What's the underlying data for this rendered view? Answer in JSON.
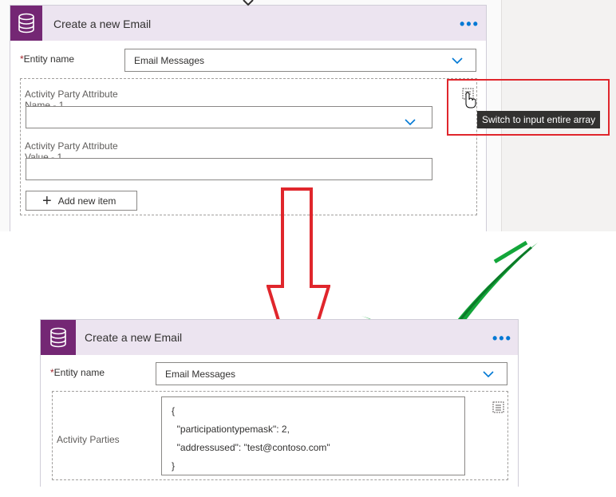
{
  "top": {
    "title": "Create a new Email",
    "more_label": "•••",
    "entity_label": "Entity name",
    "required_mark": "*",
    "entity_value": "Email Messages",
    "item": {
      "name_label_line1": "Activity Party Attribute",
      "name_label_line2": "Name - 1",
      "value_label_line1": "Activity Party Attribute",
      "value_label_line2": "Value - 1",
      "add_label": "Add new item"
    },
    "tooltip": "Switch to input entire array"
  },
  "bottom": {
    "title": "Create a new Email",
    "more_label": "•••",
    "entity_label": "Entity name",
    "required_mark": "*",
    "entity_value": "Email Messages",
    "array_label": "Activity Parties",
    "json_lines": [
      "{",
      "  \"participationtypemask\": 2,",
      "  \"addressused\": \"test@contoso.com\"",
      "}"
    ]
  },
  "colors": {
    "accent": "#742774",
    "link": "#0078d4",
    "arrow": "#e0262c",
    "check": "#13a63a"
  }
}
